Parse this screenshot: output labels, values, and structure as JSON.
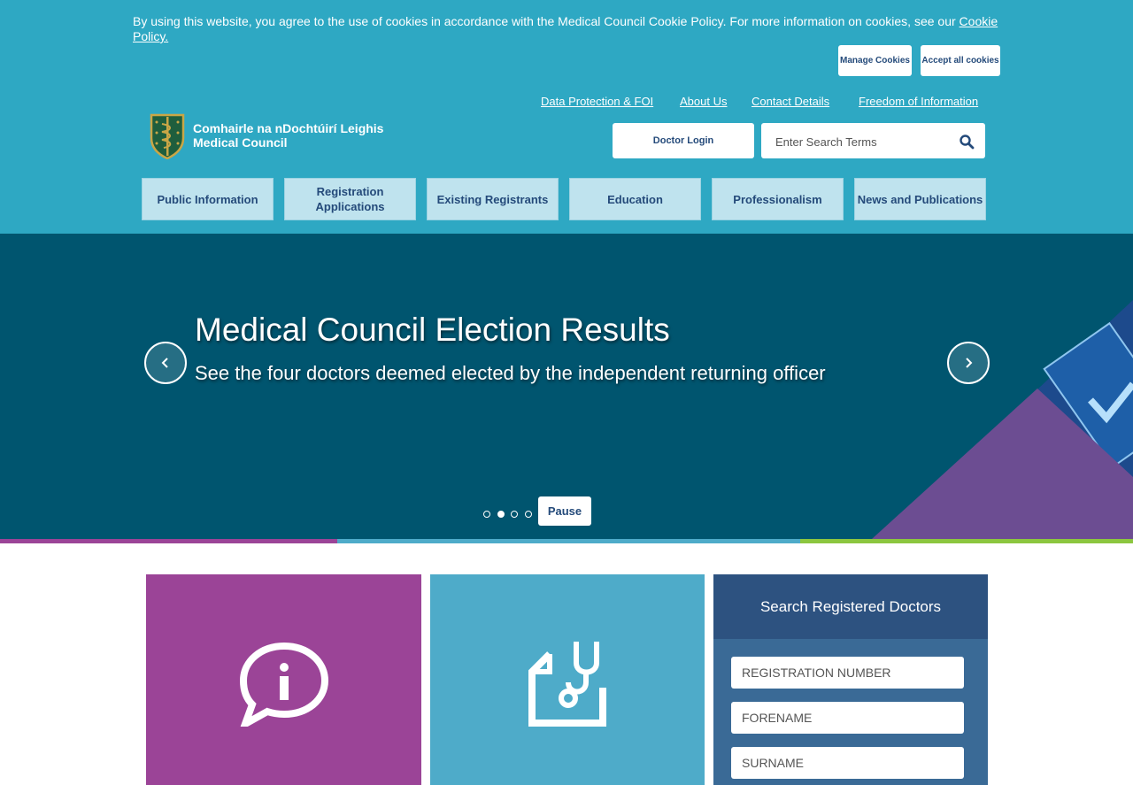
{
  "cookie_bar": {
    "text": "By using this website, you agree to the use of cookies in accordance with the Medical Council Cookie Policy. For more information on cookies, see our ",
    "link": "Cookie Policy.",
    "manage_label": "Manage Cookies",
    "accept_label": "Accept all cookies"
  },
  "utility_nav": [
    "Data Protection & FOI",
    "About Us",
    "Contact Details",
    "Freedom of Information"
  ],
  "logo": {
    "irish_name": "Comhairle na nDochtúirí Leighis",
    "english_name": "Medical Council"
  },
  "header": {
    "doctor_login": "Doctor Login",
    "search_placeholder": "Enter Search Terms"
  },
  "main_nav": [
    "Public Information",
    "Registration Applications",
    "Existing Registrants",
    "Education",
    "Professionalism",
    "News and Publications"
  ],
  "hero": {
    "title": "Medical Council Election Results",
    "subtitle": "See the four doctors deemed elected by the independent returning officer",
    "pause_label": "Pause",
    "slide_count": 4,
    "active_slide": 2
  },
  "search_doctors": {
    "heading": "Search Registered Doctors",
    "registration_placeholder": "REGISTRATION NUMBER",
    "forename_placeholder": "FORENAME",
    "surname_placeholder": "SURNAME"
  },
  "colors": {
    "header_blue": "#2ea8c3",
    "hero_teal": "#00556f",
    "purple": "#9b4497",
    "light_blue": "#4eabc9",
    "navy": "#2d5280",
    "green": "#8cc63f"
  }
}
